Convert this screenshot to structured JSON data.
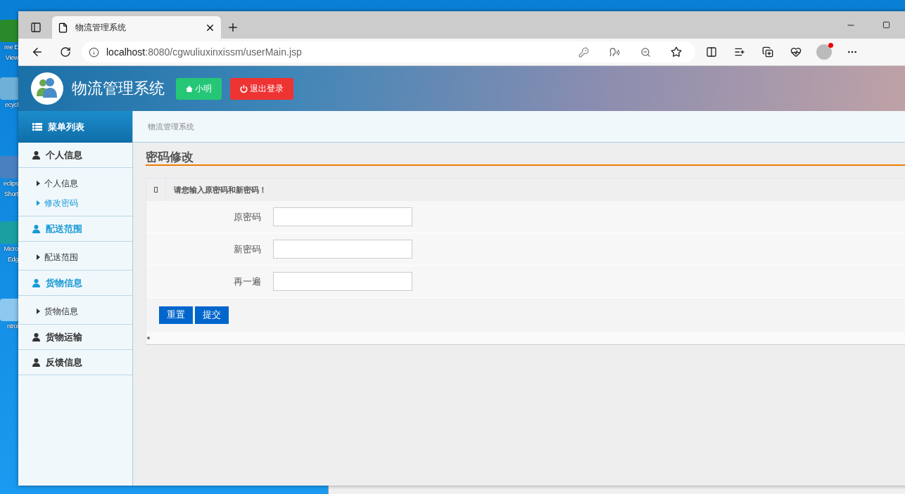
{
  "desktop": {
    "icons": [
      {
        "lines": [
          "ree E",
          "View"
        ]
      },
      {
        "lines": [
          "ecycl"
        ]
      },
      {
        "lines": [
          "eclips",
          "Short"
        ]
      },
      {
        "lines": [
          "Micro",
          "Edg"
        ]
      },
      {
        "lines": [
          "ntrol"
        ]
      }
    ]
  },
  "browser": {
    "tab": {
      "title": "物流管理系统"
    },
    "address": {
      "host": "localhost",
      "path": ":8080/cgwuliuxinxissm/userMain.jsp"
    }
  },
  "header": {
    "title": "物流管理系统",
    "user_button": "小明",
    "logout_button": "退出登录"
  },
  "sidebar": {
    "title": "菜单列表",
    "groups": [
      {
        "label": "个人信息",
        "highlighted": false,
        "children": [
          {
            "label": "个人信息",
            "selected": false
          },
          {
            "label": "修改密码",
            "selected": true
          }
        ]
      },
      {
        "label": "配送范围",
        "highlighted": true,
        "children": [
          {
            "label": "配送范围",
            "selected": false
          }
        ]
      },
      {
        "label": "货物信息",
        "highlighted": true,
        "children": [
          {
            "label": "货物信息",
            "selected": false
          }
        ]
      },
      {
        "label": "货物运输",
        "highlighted": false
      },
      {
        "label": "反馈信息",
        "highlighted": false
      }
    ]
  },
  "breadcrumb": "物流管理系统",
  "page_title": "密码修改",
  "form": {
    "notice": "请您输入原密码和新密码！",
    "fields": [
      {
        "label": "原密码"
      },
      {
        "label": "新密码"
      },
      {
        "label": "再一遍"
      }
    ],
    "buttons": [
      "重置",
      "提交"
    ]
  }
}
